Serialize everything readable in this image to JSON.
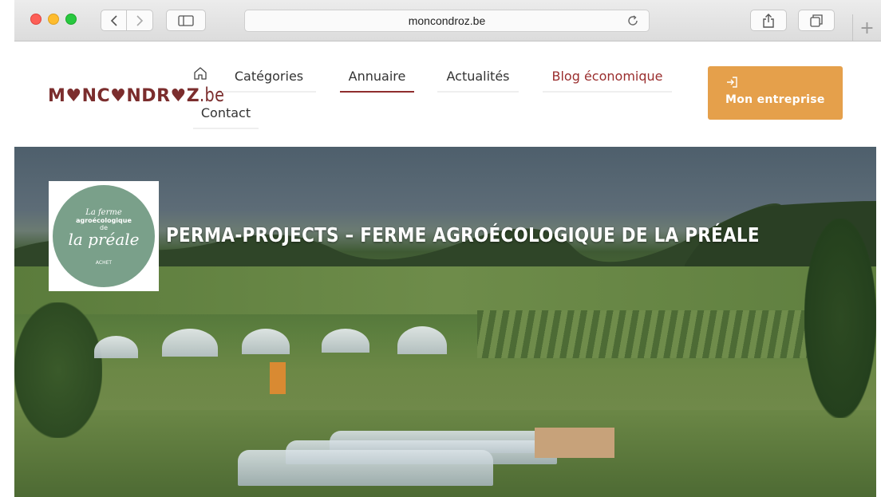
{
  "browser": {
    "url": "moncondroz.be",
    "new_tab_label": "+"
  },
  "header": {
    "logo_main": "M♥NC♥NDR♥Z",
    "logo_suffix": ".be",
    "nav": {
      "categories": "Catégories",
      "annuaire": "Annuaire",
      "actualites": "Actualités",
      "blog": "Blog économique",
      "contact": "Contact"
    },
    "cta_label": "Mon entreprise"
  },
  "hero": {
    "title": "PERMA-PROJECTS – FERME AGROÉCOLOGIQUE DE LA PRÉALE",
    "farm_logo": {
      "line1": "La ferme",
      "line2": "agroécologique",
      "line3": "de",
      "line4": "la préale",
      "line5": "ACHET"
    }
  },
  "colors": {
    "brand": "#7b2d2d",
    "accent": "#e5a04b",
    "active_underline": "#8f2d2d"
  }
}
